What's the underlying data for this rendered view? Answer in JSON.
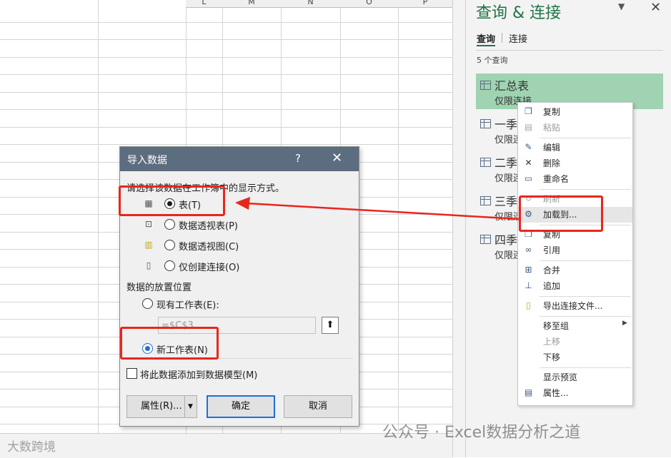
{
  "spreadsheet": {
    "columns": [
      "L",
      "M",
      "N",
      "O",
      "P"
    ]
  },
  "query_pane": {
    "title": "查询 & 连接",
    "menu_icon": "chevron-down-icon",
    "close_icon": "close-icon",
    "tab_queries": "查询",
    "tab_connections": "连接",
    "count": "5 个查询",
    "items": [
      {
        "name": "汇总表",
        "sub": "仅限连接"
      },
      {
        "name": "一季",
        "sub": "仅限连"
      },
      {
        "name": "二季",
        "sub": "仅限连"
      },
      {
        "name": "三季",
        "sub": "仅限连"
      },
      {
        "name": "四季",
        "sub": "仅限连"
      }
    ]
  },
  "context_menu": {
    "items": [
      {
        "label": "复制",
        "icon": "copy-icon"
      },
      {
        "label": "粘贴",
        "icon": "paste-icon"
      },
      {
        "label": "编辑",
        "icon": "edit-icon"
      },
      {
        "label": "删除",
        "icon": "delete-icon"
      },
      {
        "label": "重命名",
        "icon": "rename-icon"
      },
      {
        "label": "刷新",
        "icon": "refresh-icon"
      },
      {
        "label": "加载到...",
        "icon": "load-to-icon"
      },
      {
        "label": "复制",
        "icon": "duplicate-icon"
      },
      {
        "label": "引用",
        "icon": "reference-icon"
      },
      {
        "label": "合并",
        "icon": "merge-icon"
      },
      {
        "label": "追加",
        "icon": "append-icon"
      },
      {
        "label": "导出连接文件...",
        "icon": "export-icon"
      },
      {
        "label": "移至组"
      },
      {
        "label": "上移"
      },
      {
        "label": "下移"
      },
      {
        "label": "显示预览"
      },
      {
        "label": "属性...",
        "icon": "properties-icon"
      }
    ]
  },
  "dialog": {
    "title": "导入数据",
    "help": "?",
    "close": "✕",
    "display_prompt": "请选择该数据在工作簿中的显示方式。",
    "options": [
      {
        "label": "表(T)",
        "selected": true
      },
      {
        "label": "数据透视表(P)",
        "selected": false
      },
      {
        "label": "数据透视图(C)",
        "selected": false
      },
      {
        "label": "仅创建连接(O)",
        "selected": false
      }
    ],
    "placement_label": "数据的放置位置",
    "existing_sheet": "现有工作表(E):",
    "cell_ref": "=$C$3",
    "new_sheet": "新工作表(N)",
    "new_sheet_selected": true,
    "add_to_model": "将此数据添加到数据模型(M)",
    "add_to_model_checked": false,
    "buttons": {
      "properties": "属性(R)...",
      "ok": "确定",
      "cancel": "取消"
    }
  },
  "annotation_color": "#e8261d",
  "watermarks": {
    "main": "公众号 · Excel数据分析之道",
    "corner": "大数跨境"
  }
}
